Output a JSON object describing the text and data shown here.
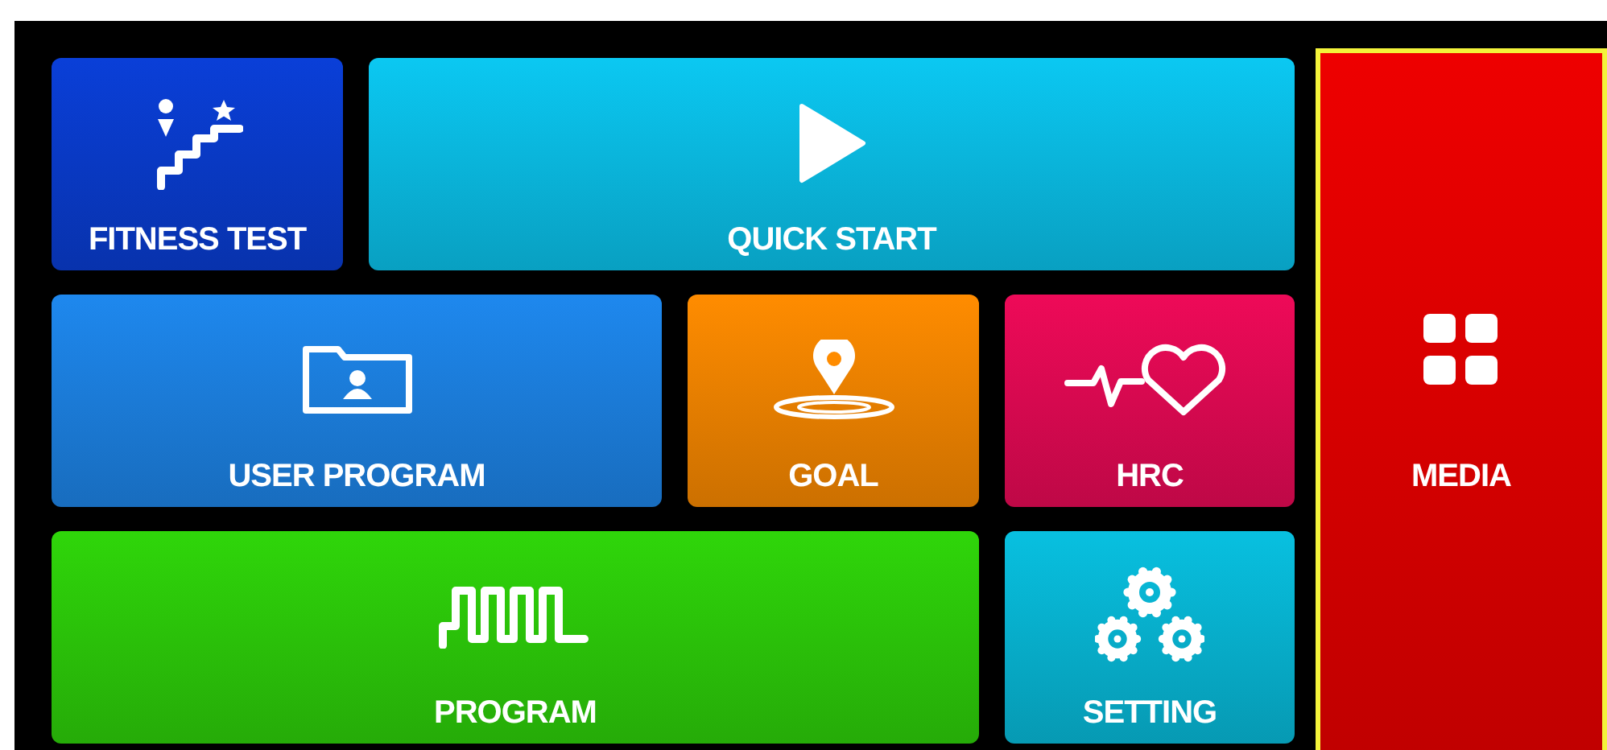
{
  "tiles": [
    {
      "label": "FITNESS TEST",
      "kind": "fitness",
      "color": "#0a3fd8",
      "selected": false
    },
    {
      "label": "QUICK START",
      "kind": "play",
      "color": "#0bc8f2",
      "selected": false
    },
    {
      "label": "USER PROGRAM",
      "kind": "folder",
      "color": "#1e88ee",
      "selected": false
    },
    {
      "label": "GOAL",
      "kind": "pin",
      "color": "#ff8c00",
      "selected": false
    },
    {
      "label": "HRC",
      "kind": "heart",
      "color": "#ee0a58",
      "selected": false
    },
    {
      "label": "PROGRAM",
      "kind": "pulse",
      "color": "#2fd60a",
      "selected": false
    },
    {
      "label": "SETTING",
      "kind": "gears",
      "color": "#08c0e0",
      "selected": false
    },
    {
      "label": "MEDIA",
      "kind": "grid",
      "color": "#ee0000",
      "selected": true
    }
  ]
}
